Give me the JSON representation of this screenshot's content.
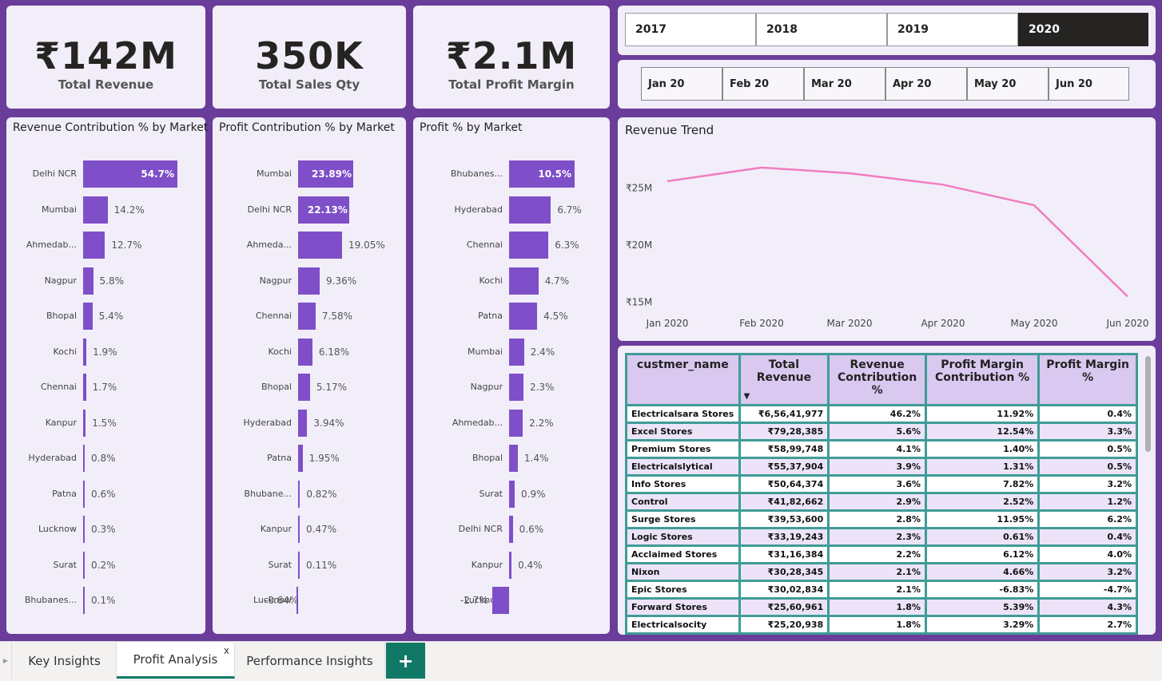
{
  "kpis": [
    {
      "value": "₹142M",
      "label": "Total Revenue"
    },
    {
      "value": "350K",
      "label": "Total Sales Qty"
    },
    {
      "value": "₹2.1M",
      "label": "Total Profit Margin"
    }
  ],
  "years": {
    "items": [
      "2017",
      "2018",
      "2019",
      "2020"
    ],
    "selected": "2020"
  },
  "months": [
    "Jan 20",
    "Feb 20",
    "Mar 20",
    "Apr 20",
    "May 20",
    "Jun 20"
  ],
  "bar_charts": [
    {
      "title": "Revenue Contribution % by Market",
      "max": 54.7,
      "rows": [
        {
          "cat": "Delhi NCR",
          "value": 54.7,
          "label": "54.7%"
        },
        {
          "cat": "Mumbai",
          "value": 14.2,
          "label": "14.2%"
        },
        {
          "cat": "Ahmedab...",
          "value": 12.7,
          "label": "12.7%"
        },
        {
          "cat": "Nagpur",
          "value": 5.8,
          "label": "5.8%"
        },
        {
          "cat": "Bhopal",
          "value": 5.4,
          "label": "5.4%"
        },
        {
          "cat": "Kochi",
          "value": 1.9,
          "label": "1.9%"
        },
        {
          "cat": "Chennai",
          "value": 1.7,
          "label": "1.7%"
        },
        {
          "cat": "Kanpur",
          "value": 1.5,
          "label": "1.5%"
        },
        {
          "cat": "Hyderabad",
          "value": 0.8,
          "label": "0.8%"
        },
        {
          "cat": "Patna",
          "value": 0.6,
          "label": "0.6%"
        },
        {
          "cat": "Lucknow",
          "value": 0.3,
          "label": "0.3%"
        },
        {
          "cat": "Surat",
          "value": 0.2,
          "label": "0.2%"
        },
        {
          "cat": "Bhubanes...",
          "value": 0.1,
          "label": "0.1%"
        }
      ]
    },
    {
      "title": "Profit Contribution % by Market",
      "max": 23.89,
      "rows": [
        {
          "cat": "Mumbai",
          "value": 23.89,
          "label": "23.89%"
        },
        {
          "cat": "Delhi NCR",
          "value": 22.13,
          "label": "22.13%"
        },
        {
          "cat": "Ahmeda...",
          "value": 19.05,
          "label": "19.05%"
        },
        {
          "cat": "Nagpur",
          "value": 9.36,
          "label": "9.36%"
        },
        {
          "cat": "Chennai",
          "value": 7.58,
          "label": "7.58%"
        },
        {
          "cat": "Kochi",
          "value": 6.18,
          "label": "6.18%"
        },
        {
          "cat": "Bhopal",
          "value": 5.17,
          "label": "5.17%"
        },
        {
          "cat": "Hyderabad",
          "value": 3.94,
          "label": "3.94%"
        },
        {
          "cat": "Patna",
          "value": 1.95,
          "label": "1.95%"
        },
        {
          "cat": "Bhubane...",
          "value": 0.82,
          "label": "0.82%"
        },
        {
          "cat": "Kanpur",
          "value": 0.47,
          "label": "0.47%"
        },
        {
          "cat": "Surat",
          "value": 0.11,
          "label": "0.11%"
        },
        {
          "cat": "Lucknow",
          "value": -0.64,
          "label": "-0.64%"
        }
      ]
    },
    {
      "title": "Profit % by Market",
      "max": 10.5,
      "rows": [
        {
          "cat": "Bhubanes...",
          "value": 10.5,
          "label": "10.5%"
        },
        {
          "cat": "Hyderabad",
          "value": 6.7,
          "label": "6.7%"
        },
        {
          "cat": "Chennai",
          "value": 6.3,
          "label": "6.3%"
        },
        {
          "cat": "Kochi",
          "value": 4.7,
          "label": "4.7%"
        },
        {
          "cat": "Patna",
          "value": 4.5,
          "label": "4.5%"
        },
        {
          "cat": "Mumbai",
          "value": 2.4,
          "label": "2.4%"
        },
        {
          "cat": "Nagpur",
          "value": 2.3,
          "label": "2.3%"
        },
        {
          "cat": "Ahmedab...",
          "value": 2.2,
          "label": "2.2%"
        },
        {
          "cat": "Bhopal",
          "value": 1.4,
          "label": "1.4%"
        },
        {
          "cat": "Surat",
          "value": 0.9,
          "label": "0.9%"
        },
        {
          "cat": "Delhi NCR",
          "value": 0.6,
          "label": "0.6%"
        },
        {
          "cat": "Kanpur",
          "value": 0.4,
          "label": "0.4%"
        },
        {
          "cat": "Lucknow",
          "value": -2.7,
          "label": "-2.7%"
        }
      ]
    }
  ],
  "chart_data": {
    "type": "line",
    "title": "Revenue Trend",
    "x": [
      "Jan 2020",
      "Feb 2020",
      "Mar 2020",
      "Apr 2020",
      "May 2020",
      "Jun 2020"
    ],
    "values": [
      25.6,
      26.8,
      26.3,
      25.3,
      23.5,
      15.5
    ],
    "yticks": [
      "₹25M",
      "₹20M",
      "₹15M"
    ],
    "ytick_values": [
      25,
      20,
      15
    ],
    "ylim": [
      14.2,
      28.4
    ],
    "color": "#f07dbf"
  },
  "table": {
    "headers": [
      "custmer_name",
      "Total Revenue",
      "Revenue Contribution %",
      "Profit Margin Contribution %",
      "Profit Margin %"
    ],
    "rows": [
      [
        "Electricalsara Stores",
        "₹6,56,41,977",
        "46.2%",
        "11.92%",
        "0.4%"
      ],
      [
        "Excel Stores",
        "₹79,28,385",
        "5.6%",
        "12.54%",
        "3.3%"
      ],
      [
        "Premium Stores",
        "₹58,99,748",
        "4.1%",
        "1.40%",
        "0.5%"
      ],
      [
        "Electricalslytical",
        "₹55,37,904",
        "3.9%",
        "1.31%",
        "0.5%"
      ],
      [
        "Info Stores",
        "₹50,64,374",
        "3.6%",
        "7.82%",
        "3.2%"
      ],
      [
        "Control",
        "₹41,82,662",
        "2.9%",
        "2.52%",
        "1.2%"
      ],
      [
        "Surge Stores",
        "₹39,53,600",
        "2.8%",
        "11.95%",
        "6.2%"
      ],
      [
        "Logic Stores",
        "₹33,19,243",
        "2.3%",
        "0.61%",
        "0.4%"
      ],
      [
        "Acclaimed Stores",
        "₹31,16,384",
        "2.2%",
        "6.12%",
        "4.0%"
      ],
      [
        "Nixon",
        "₹30,28,345",
        "2.1%",
        "4.66%",
        "3.2%"
      ],
      [
        "Epic Stores",
        "₹30,02,834",
        "2.1%",
        "-6.83%",
        "-4.7%"
      ],
      [
        "Forward Stores",
        "₹25,60,961",
        "1.8%",
        "5.39%",
        "4.3%"
      ],
      [
        "Electricalsocity",
        "₹25,20,938",
        "1.8%",
        "3.29%",
        "2.7%"
      ]
    ]
  },
  "tabs": {
    "items": [
      "Key Insights",
      "Profit Analysis",
      "Performance Insights"
    ],
    "active": "Profit Analysis",
    "close_glyph": "x",
    "add_glyph": "+"
  }
}
